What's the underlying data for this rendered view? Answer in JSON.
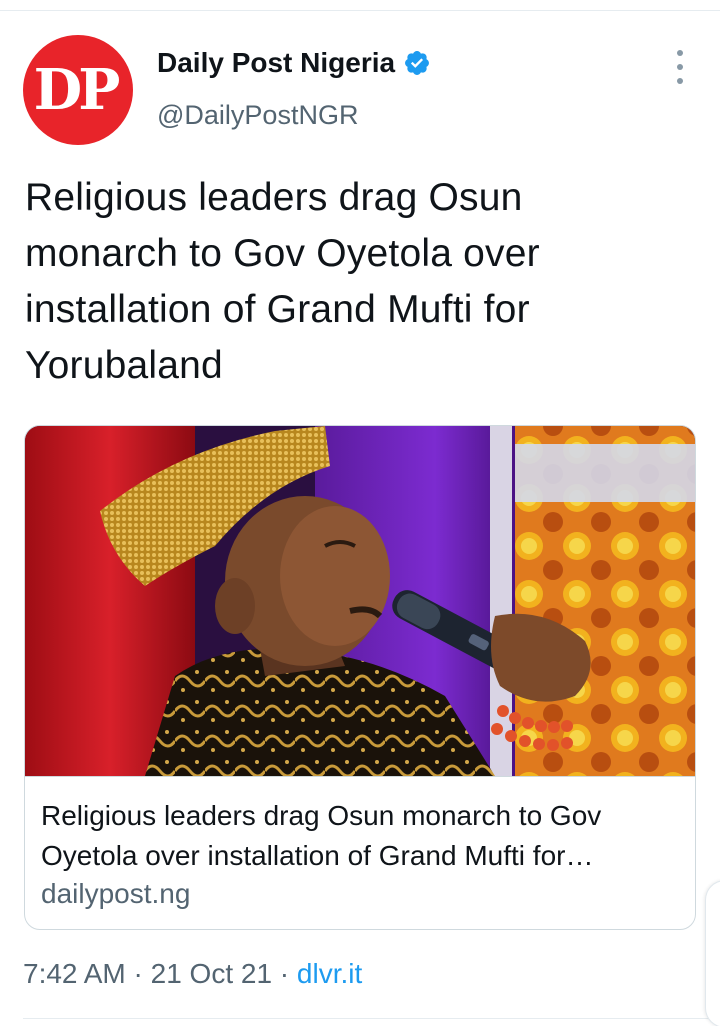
{
  "author": {
    "avatar_text": "DP",
    "display_name": "Daily Post Nigeria",
    "handle": "@DailyPostNGR",
    "verified": true,
    "avatar_color": "#e8242a"
  },
  "tweet": {
    "text": "Religious leaders drag Osun monarch to Gov Oyetola over installation of Grand Mufti for Yorubaland"
  },
  "card": {
    "image_alt": "monarch holding a microphone",
    "title": "Religious leaders drag Osun monarch to Gov Oyetola over installation of Grand Mufti for Yorubaland",
    "domain": "dailypost.ng"
  },
  "meta": {
    "time": "7:42 AM",
    "separator": " · ",
    "date": "21 Oct 21",
    "source": "dlvr.it"
  },
  "colors": {
    "link": "#1d9bf0",
    "secondary_text": "#536471",
    "verified_badge": "#1d9bf0"
  },
  "icons": {
    "more": "more-vertical-icon",
    "verified": "verified-badge-icon"
  }
}
